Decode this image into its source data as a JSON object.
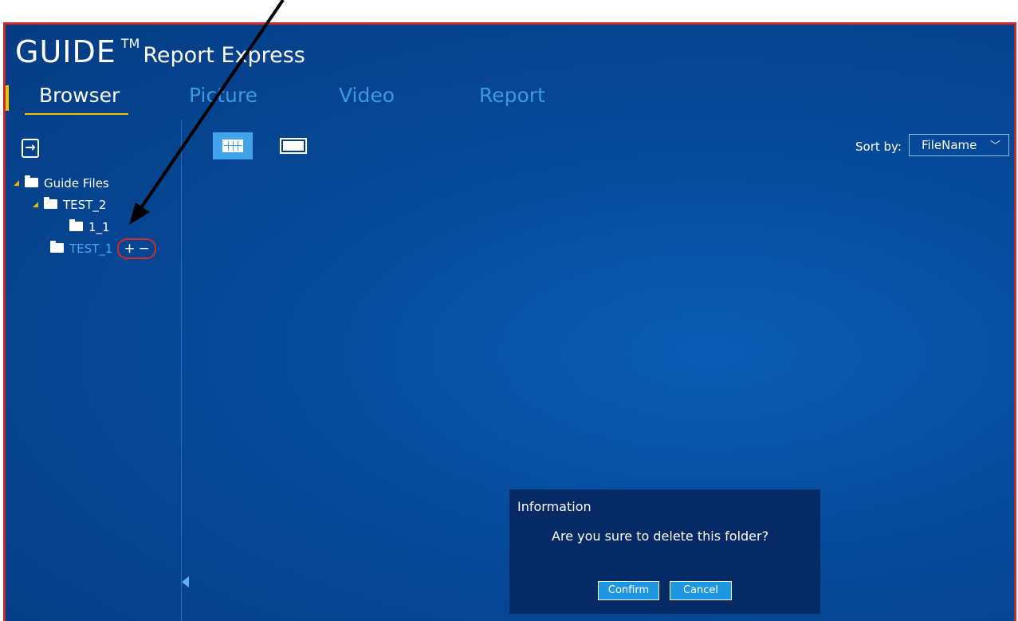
{
  "app": {
    "brand": {
      "name": "GUIDE",
      "tm": "TM",
      "product": "Report Express"
    }
  },
  "tabs": [
    {
      "label": "Browser",
      "active": true
    },
    {
      "label": "Picture",
      "active": false
    },
    {
      "label": "Video",
      "active": false
    },
    {
      "label": "Report",
      "active": false
    }
  ],
  "toolbar": {
    "exit_icon": "exit-icon",
    "grid_view_icon": "grid-view-icon",
    "single_view_icon": "single-view-icon",
    "sort_label": "Sort by:",
    "sort_value": "FileName"
  },
  "tree": {
    "items": [
      {
        "label": "Guide Files",
        "expanded": true
      },
      {
        "label": "TEST_2",
        "expanded": true
      },
      {
        "label": "1_1"
      },
      {
        "label": "TEST_1",
        "selected": true
      }
    ],
    "add_symbol": "+",
    "remove_symbol": "−"
  },
  "dialog": {
    "title": "Information",
    "message": "Are you sure to delete this folder?",
    "confirm_label": "Confirm",
    "cancel_label": "Cancel"
  },
  "colors": {
    "background": "#064a9a",
    "accent": "#f2c400",
    "inactive_tab": "#3c9be0",
    "highlight_border": "#c42a2a",
    "dialog_bg": "#062a66",
    "button": "#1f96e0"
  }
}
